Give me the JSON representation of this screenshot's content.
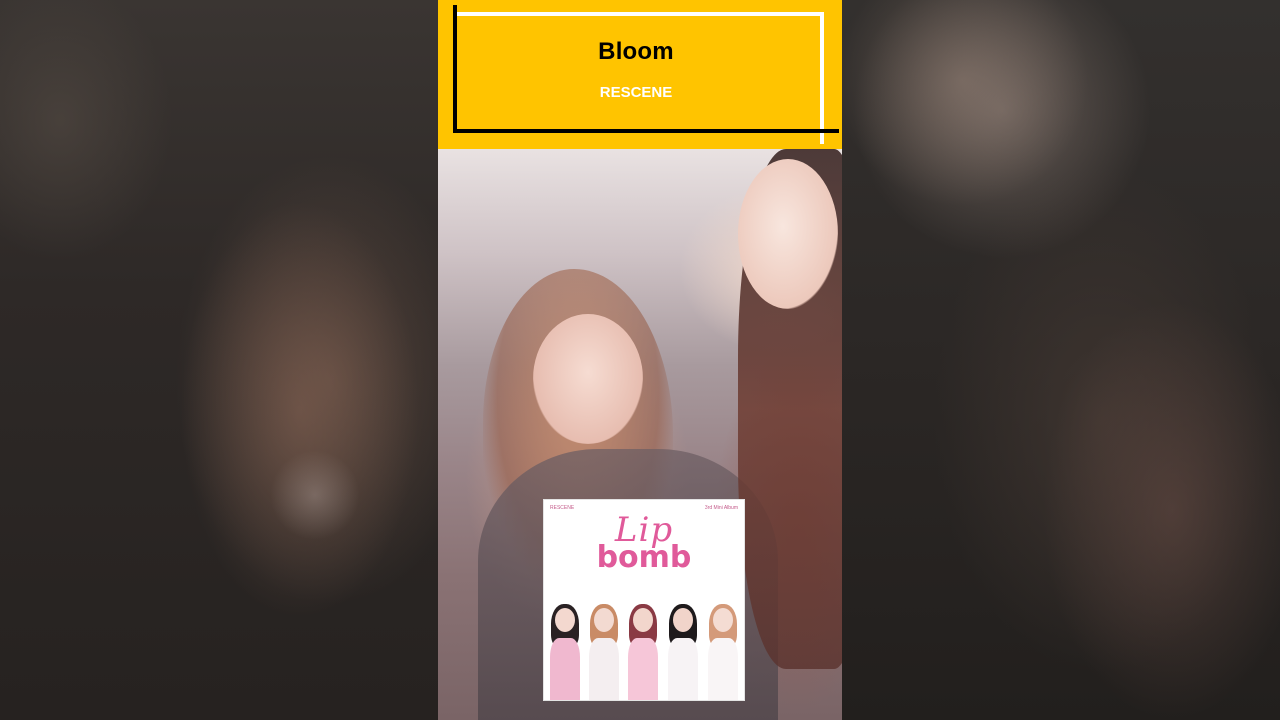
{
  "banner": {
    "title": "Bloom",
    "artist": "RESCENE"
  },
  "album": {
    "label_left": "RESCENE",
    "label_right": "3rd Mini Album",
    "title_line1": "Lip",
    "title_line2": "bomb"
  },
  "colors": {
    "banner": "#ffc400",
    "album_title": "#e05a9a"
  }
}
